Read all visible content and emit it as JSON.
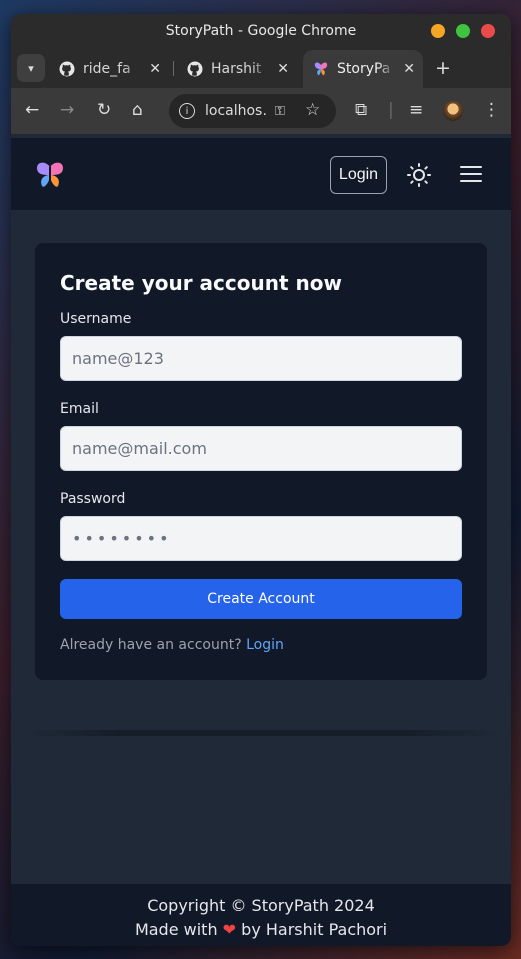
{
  "browser": {
    "window_title": "StoryPath - Google Chrome",
    "tabs": [
      {
        "label": "ride_fa",
        "icon": "github-icon"
      },
      {
        "label": "Harshit",
        "icon": "github-icon"
      },
      {
        "label": "StoryPa",
        "icon": "butterfly-icon",
        "active": true
      }
    ],
    "url": "localhos…"
  },
  "nav": {
    "login_label": "Login"
  },
  "form": {
    "title": "Create your account now",
    "username_label": "Username",
    "username_placeholder": "name@123",
    "email_label": "Email",
    "email_placeholder": "name@mail.com",
    "password_label": "Password",
    "password_value": "••••••••",
    "submit_label": "Create Account",
    "already_text": "Already have an account?",
    "login_link": "Login"
  },
  "footer": {
    "copyright": "Copyright © StoryPath 2024",
    "made_with": "Made with",
    "by": "by Harshit Pachori"
  },
  "colors": {
    "accent": "#2563eb",
    "link": "#60a5fa",
    "heart": "#ef4444",
    "page_bg": "#1f2937",
    "card_bg": "#111827"
  }
}
